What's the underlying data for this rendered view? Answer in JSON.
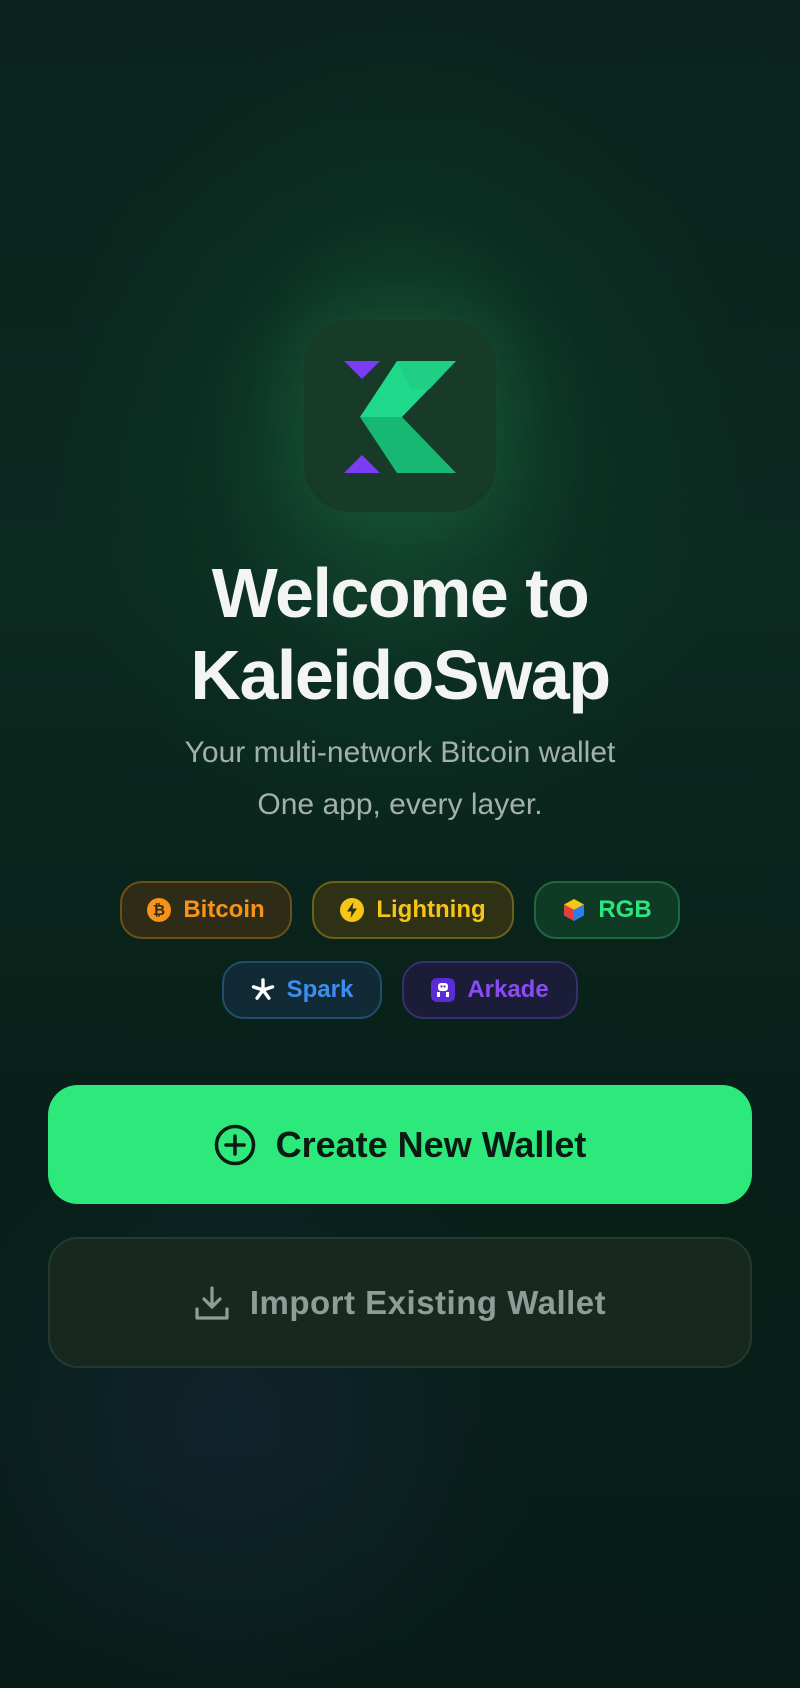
{
  "app": {
    "icon_name": "kaleidoswap-logo",
    "title_line1": "Welcome to",
    "title_line2": "KaleidoSwap",
    "subtitle_line1": "Your multi-network Bitcoin wallet",
    "subtitle_line2": "One app, every layer."
  },
  "networks": [
    {
      "label": "Bitcoin",
      "icon": "bitcoin-icon",
      "color": "#f7931a"
    },
    {
      "label": "Lightning",
      "icon": "lightning-icon",
      "color": "#f5c518"
    },
    {
      "label": "RGB",
      "icon": "rgb-cube-icon",
      "color": "#2de57c"
    },
    {
      "label": "Spark",
      "icon": "spark-asterisk-icon",
      "color": "#3b8ff0"
    },
    {
      "label": "Arkade",
      "icon": "arkade-icon",
      "color": "#8a4cf2"
    }
  ],
  "actions": {
    "create_label": "Create New Wallet",
    "create_icon": "plus-circle-icon",
    "import_label": "Import Existing Wallet",
    "import_icon": "download-icon"
  },
  "colors": {
    "accent": "#2de87a",
    "logo_green": "#1fd88a",
    "logo_purple": "#7b3cf5"
  }
}
